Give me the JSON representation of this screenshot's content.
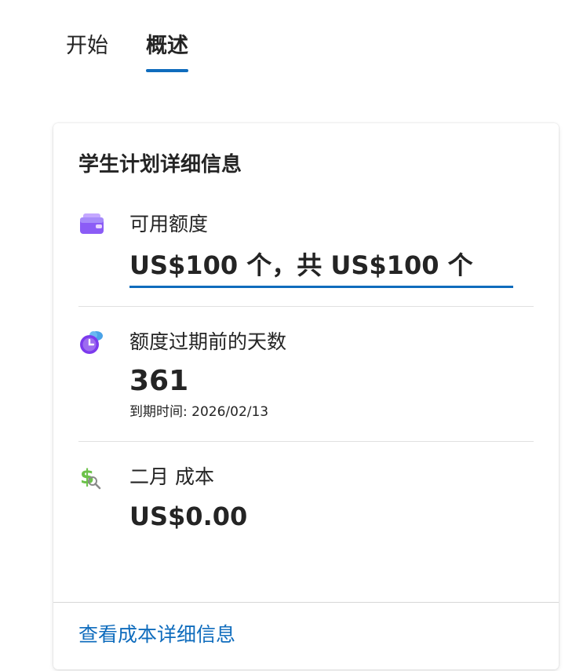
{
  "tabs": [
    {
      "label": "开始",
      "active": false
    },
    {
      "label": "概述",
      "active": true
    }
  ],
  "card": {
    "title": "学生计划详细信息",
    "credit": {
      "icon": "wallet-icon",
      "label": "可用额度",
      "value": "US$100 个，共 US$100 个"
    },
    "days": {
      "icon": "clock-cloud-icon",
      "label": "额度过期前的天数",
      "value": "361",
      "sub": "到期时间: 2026/02/13"
    },
    "cost": {
      "icon": "dollar-search-icon",
      "label": "二月 成本",
      "value": "US$0.00"
    },
    "footer_link": "查看成本详细信息"
  },
  "colors": {
    "accent": "#0f6cbd",
    "wallet": "#8b5cf6",
    "clock": "#7c3aed",
    "dollar": "#6cc24a"
  }
}
